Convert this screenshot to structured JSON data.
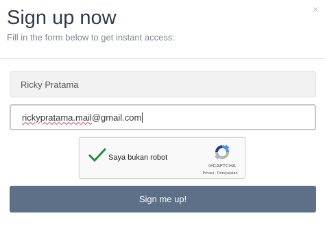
{
  "header": {
    "title": "Sign up now",
    "subtitle": "Fill in the form below to get instant access:",
    "close_glyph": "×"
  },
  "form": {
    "name_value": "Ricky Pratama",
    "email_user": "rickypratama.mail",
    "email_domain": "@gmail.com",
    "captcha": {
      "label": "Saya bukan robot",
      "brand": "reCAPTCHA",
      "links": "Privasi - Persyaratan",
      "checked": true
    },
    "submit_label": "Sign me up!"
  },
  "colors": {
    "title": "#2f3b48",
    "subtitle": "#7b8794",
    "button": "#5d7087",
    "check": "#1e8e3e"
  }
}
